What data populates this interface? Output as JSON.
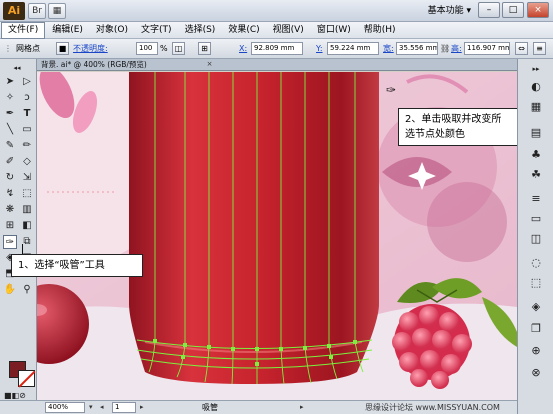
{
  "app": {
    "logo": "Ai",
    "workspace": "基本功能 ▾",
    "window_buttons": [
      "–",
      "□",
      "×"
    ]
  },
  "menu": [
    {
      "label": "文件(F)"
    },
    {
      "label": "编辑(E)"
    },
    {
      "label": "对象(O)"
    },
    {
      "label": "文字(T)"
    },
    {
      "label": "选择(S)"
    },
    {
      "label": "效果(C)"
    },
    {
      "label": "视图(V)"
    },
    {
      "label": "窗口(W)"
    },
    {
      "label": "帮助(H)"
    }
  ],
  "control": {
    "object_type": "网格点",
    "opacity_label": "不透明度:",
    "opacity_value": "100",
    "opacity_unit": "%",
    "x_label": "X:",
    "x_value": "92.809 mm",
    "y_label": "Y:",
    "y_value": "59.224 mm",
    "w_label": "宽:",
    "w_value": "35.556 mm",
    "h_label": "高:",
    "h_value": "116.907 mm"
  },
  "document": {
    "tab_label": "背景. ai* @ 400% (RGB/预览)",
    "tab_close": "×"
  },
  "status": {
    "zoom": "400%",
    "page": "1",
    "current_tool": "吸管",
    "watermark": "思缘设计论坛 www.MISSYUAN.COM"
  },
  "callouts": {
    "step1": "1、选择“吸管”工具",
    "step2_line1": "2、单击吸取并改变所",
    "step2_line2": "选节点处颜色"
  },
  "colors": {
    "fill": "#7a1e24",
    "bottle": "#c0222d",
    "mesh_line": "#7cf03e",
    "background_pink": "#e9c3d3"
  }
}
